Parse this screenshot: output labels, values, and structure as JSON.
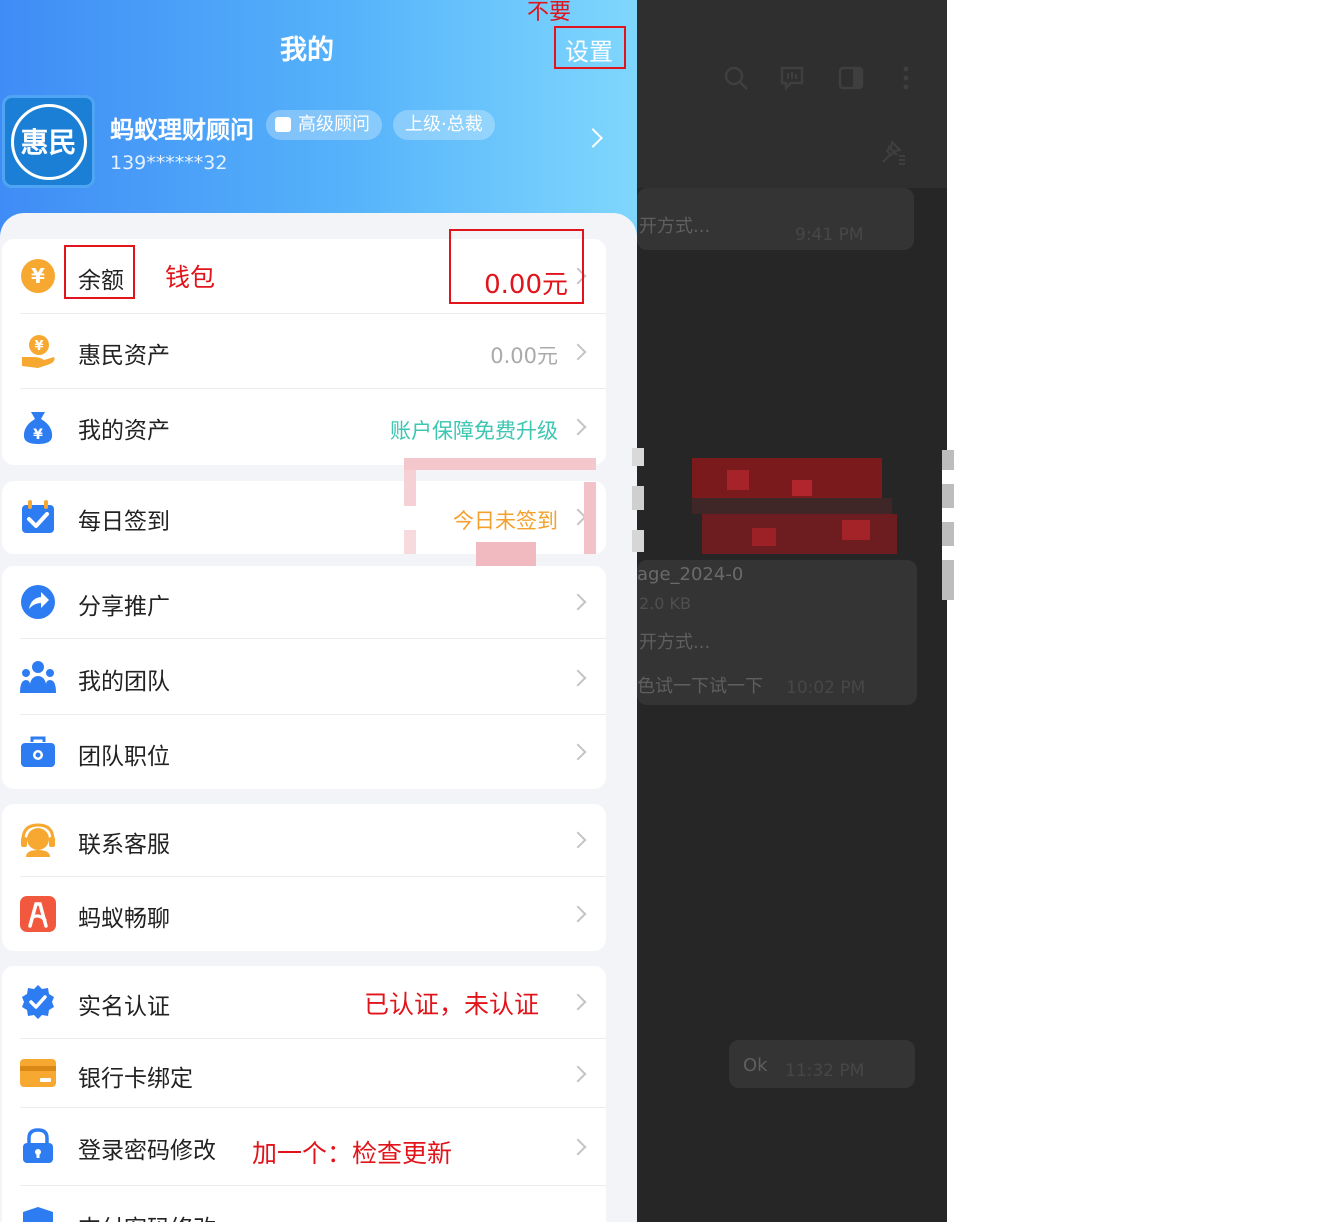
{
  "header": {
    "title": "我的",
    "settings_label": "设置"
  },
  "profile": {
    "avatar_text": "惠民",
    "name": "蚂蚁理财顾问",
    "badge_level": "高级顾问",
    "badge_superior": "上级·总裁",
    "phone": "139******32"
  },
  "wallet_card": {
    "balance_label": "余额",
    "balance_value": "0.00元",
    "asset_label": "惠民资产",
    "asset_value": "0.00元",
    "my_assets_label": "我的资产",
    "my_assets_value": "账户保障免费升级"
  },
  "checkin_card": {
    "label": "每日签到",
    "value": "今日未签到"
  },
  "team_card": {
    "share_label": "分享推广",
    "team_label": "我的团队",
    "position_label": "团队职位"
  },
  "service_card": {
    "support_label": "联系客服",
    "chat_label": "蚂蚁畅聊"
  },
  "security_card": {
    "realname_label": "实名认证",
    "bankcard_label": "银行卡绑定",
    "password_label": "登录密码修改",
    "paypwd_label": "支付密码修改"
  },
  "annotations": {
    "settings_note": "不要",
    "balance_note": "钱包",
    "realname_note": "已认证，未认证",
    "password_note": "加一个：检查更新"
  },
  "chat": {
    "msg1_partial": "开方式...",
    "msg1_time": "9:41 PM",
    "file_name_partial": "age_2024-0",
    "file_size_partial": "2.0 KB",
    "msg2_partial": "开方式...",
    "msg3_partial": "色试一下试一下",
    "msg3_time": "10:02 PM",
    "reply_text": "Ok",
    "reply_time": "11:32 PM"
  },
  "colors": {
    "accent_blue": "#3f8cf6",
    "annotation_red": "#e0141a",
    "checkin_orange": "#f3a12c",
    "upgrade_teal": "#3dc6b1"
  }
}
